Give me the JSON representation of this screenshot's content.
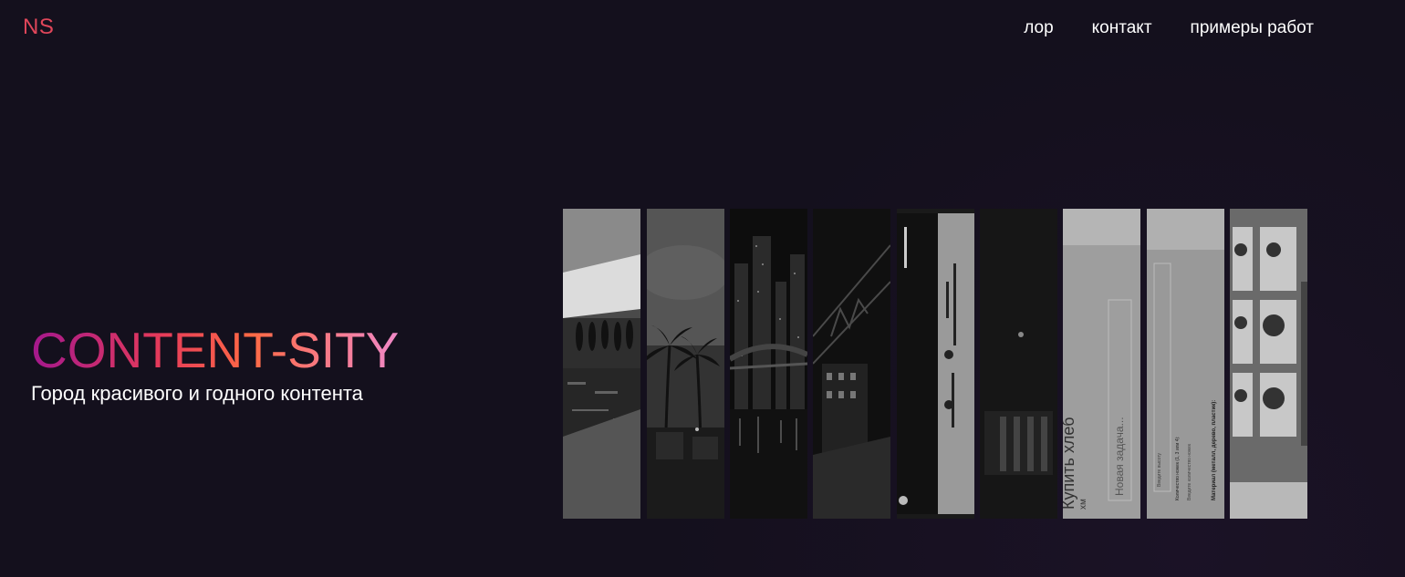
{
  "header": {
    "logo": "NS",
    "nav": [
      {
        "label": "лор"
      },
      {
        "label": "контакт"
      },
      {
        "label": "примеры работ"
      }
    ]
  },
  "hero": {
    "title": "CONTENT-SITY",
    "subtitle": "Город красивого и годного контента"
  },
  "gallery": {
    "strips": [
      {
        "name": "gallery-strip-pool"
      },
      {
        "name": "gallery-strip-palms"
      },
      {
        "name": "gallery-strip-bridge"
      },
      {
        "name": "gallery-strip-street"
      },
      {
        "name": "gallery-strip-weather-app"
      },
      {
        "name": "gallery-strip-dark-app"
      },
      {
        "name": "gallery-strip-todo-app",
        "texts": [
          "Купить хлеб",
          "хм",
          "Новая задача..."
        ]
      },
      {
        "name": "gallery-strip-form-app",
        "texts": [
          "Материал (металл, дерево, пластик):",
          "Количество ножек (1, 3 или 4):",
          "Введите количество ножек",
          "Введите высоту"
        ]
      },
      {
        "name": "gallery-strip-cards-app"
      }
    ]
  },
  "colors": {
    "background": "#14101d",
    "logo": "#e0465a",
    "title_gradient": [
      "#a4188d",
      "#e53a5a",
      "#ff6a45",
      "#f089c8"
    ]
  }
}
